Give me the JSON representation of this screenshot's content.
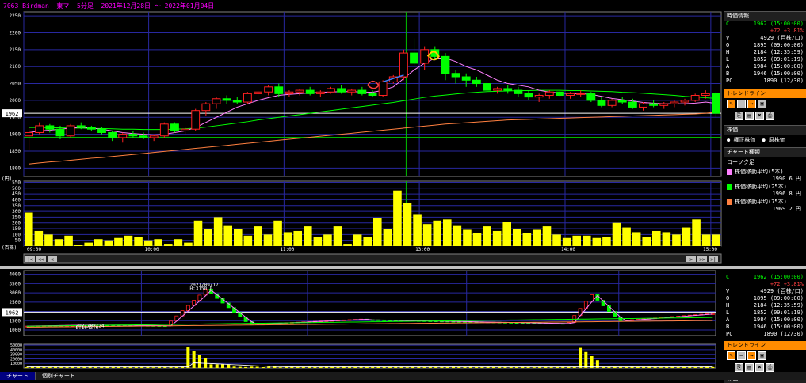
{
  "window": {
    "title": "7063 Birdman  東マ  5分足  2021年12月28日 〜 2022年01月04日"
  },
  "info_panel": {
    "header": "時価情報",
    "rows": [
      {
        "k": "C",
        "v": "1962 (15:00:00)",
        "color": "#00ff00"
      },
      {
        "k": "",
        "v": "+72 +3.81%",
        "color": "#ff4040"
      },
      {
        "k": "V",
        "v": "4929 (百株/口)",
        "color": "#ffffff"
      },
      {
        "k": "O",
        "v": "1895 (09:00:00)",
        "color": "#ffffff"
      },
      {
        "k": "H",
        "v": "2184 (12:35:59)",
        "color": "#ffffff"
      },
      {
        "k": "L",
        "v": "1852 (09:01:19)",
        "color": "#ffffff"
      },
      {
        "k": "A",
        "v": "1984 (15:00:00)",
        "color": "#ffffff"
      },
      {
        "k": "B",
        "v": "1946 (15:00:00)",
        "color": "#ffffff"
      },
      {
        "k": "PC",
        "v": "1890 (12/30)",
        "color": "#ffffff"
      }
    ]
  },
  "trendline": {
    "label": "トレンドライン"
  },
  "stock_price": {
    "header": "株価",
    "options": [
      "権正株価",
      "原株価"
    ]
  },
  "chart_type": {
    "header": "チャート種類",
    "kind": "ローソク足",
    "ma": [
      {
        "label": "株価移動平均(5本)",
        "value": "1990.6 円",
        "color": "#ff80ff"
      },
      {
        "label": "株価移動平均(25本)",
        "value": "1996.8 円",
        "color": "#00ff00"
      },
      {
        "label": "株価移動平均(75本)",
        "value": "1969.2 円",
        "color": "#ff8040"
      }
    ]
  },
  "bottom_info": {
    "rows": [
      {
        "k": "C",
        "v": "1962 (15:00:00)",
        "color": "#00ff00"
      },
      {
        "k": "",
        "v": "+72 +3.81%",
        "color": "#ff4040"
      },
      {
        "k": "V",
        "v": "4929 (百株/口)",
        "color": "#ffffff"
      },
      {
        "k": "O",
        "v": "1895 (09:00:00)",
        "color": "#ffffff"
      },
      {
        "k": "H",
        "v": "2184 (12:35:59)",
        "color": "#ffffff"
      },
      {
        "k": "L",
        "v": "1852 (09:01:19)",
        "color": "#ffffff"
      },
      {
        "k": "A",
        "v": "1984 (15:00:00)",
        "color": "#ffffff"
      },
      {
        "k": "B",
        "v": "1946 (15:00:00)",
        "color": "#ffffff"
      },
      {
        "k": "PC",
        "v": "1890 (12/30)",
        "color": "#ffffff"
      }
    ],
    "footer": "株価"
  },
  "tabs": [
    "チャート",
    "個別チャート"
  ],
  "chart_data": [
    {
      "type": "candlestick",
      "yticks": [
        1800,
        1850,
        1900,
        1950,
        2000,
        2050,
        2100,
        2150,
        2200,
        2250
      ],
      "ylim": [
        1775,
        2262
      ],
      "y_unit": "(円)",
      "current_price_label": "1962",
      "current_price": 1962,
      "hline": 1890,
      "xticks": [
        "09:00",
        "10:00",
        "11:00",
        "13:00",
        "14:00",
        "15:00"
      ],
      "candles": [
        [
          1895,
          1920,
          1852,
          1905
        ],
        [
          1905,
          1935,
          1900,
          1925
        ],
        [
          1925,
          1930,
          1905,
          1915
        ],
        [
          1915,
          1925,
          1885,
          1895
        ],
        [
          1895,
          1930,
          1890,
          1925
        ],
        [
          1925,
          1935,
          1915,
          1920
        ],
        [
          1920,
          1925,
          1910,
          1915
        ],
        [
          1915,
          1920,
          1900,
          1905
        ],
        [
          1905,
          1910,
          1880,
          1890
        ],
        [
          1890,
          1905,
          1875,
          1900
        ],
        [
          1900,
          1910,
          1890,
          1895
        ],
        [
          1895,
          1905,
          1885,
          1890
        ],
        [
          1890,
          1900,
          1880,
          1895
        ],
        [
          1895,
          1935,
          1890,
          1930
        ],
        [
          1930,
          1935,
          1905,
          1910
        ],
        [
          1910,
          1920,
          1900,
          1915
        ],
        [
          1915,
          1975,
          1910,
          1970
        ],
        [
          1970,
          1995,
          1955,
          1990
        ],
        [
          1990,
          2010,
          1975,
          2005
        ],
        [
          2005,
          2015,
          1990,
          2000
        ],
        [
          2000,
          2010,
          1990,
          1995
        ],
        [
          1995,
          2025,
          1990,
          2020
        ],
        [
          2020,
          2030,
          2005,
          2025
        ],
        [
          2025,
          2045,
          2015,
          2040
        ],
        [
          2040,
          2050,
          2010,
          2020
        ],
        [
          2020,
          2030,
          2010,
          2025
        ],
        [
          2025,
          2035,
          2015,
          2030
        ],
        [
          2030,
          2040,
          2015,
          2020
        ],
        [
          2020,
          2030,
          2010,
          2025
        ],
        [
          2025,
          2040,
          2020,
          2035
        ],
        [
          2035,
          2045,
          2020,
          2025
        ],
        [
          2025,
          2035,
          2015,
          2030
        ],
        [
          2030,
          2040,
          2015,
          2020
        ],
        [
          2020,
          2030,
          2010,
          2015
        ],
        [
          2015,
          2060,
          2010,
          2055
        ],
        [
          2055,
          2075,
          2050,
          2070
        ],
        [
          2070,
          2150,
          2060,
          2140
        ],
        [
          2140,
          2184,
          2100,
          2110
        ],
        [
          2110,
          2160,
          2090,
          2150
        ],
        [
          2150,
          2160,
          2120,
          2130
        ],
        [
          2130,
          2140,
          2060,
          2080
        ],
        [
          2080,
          2090,
          2050,
          2070
        ],
        [
          2070,
          2080,
          2040,
          2060
        ],
        [
          2060,
          2070,
          2040,
          2050
        ],
        [
          2050,
          2060,
          2020,
          2030
        ],
        [
          2030,
          2040,
          2020,
          2035
        ],
        [
          2035,
          2045,
          2020,
          2030
        ],
        [
          2030,
          2040,
          2010,
          2020
        ],
        [
          2020,
          2030,
          2000,
          2010
        ],
        [
          2010,
          2020,
          1995,
          2015
        ],
        [
          2015,
          2030,
          2005,
          2025
        ],
        [
          2025,
          2030,
          2010,
          2015
        ],
        [
          2015,
          2025,
          2005,
          2020
        ],
        [
          2020,
          2030,
          2010,
          2020
        ],
        [
          2020,
          2025,
          1995,
          2000
        ],
        [
          2000,
          2010,
          1980,
          1985
        ],
        [
          1985,
          2005,
          1980,
          2000
        ],
        [
          2000,
          2010,
          1990,
          1995
        ],
        [
          1995,
          2005,
          1975,
          1980
        ],
        [
          1980,
          1995,
          1970,
          1990
        ],
        [
          1990,
          2000,
          1980,
          1985
        ],
        [
          1985,
          1995,
          1975,
          1990
        ],
        [
          1990,
          2000,
          1980,
          1995
        ],
        [
          1995,
          2005,
          1985,
          2000
        ],
        [
          2000,
          2020,
          1995,
          2015
        ],
        [
          2015,
          2030,
          2005,
          2020
        ],
        [
          2020,
          2025,
          1950,
          1962
        ]
      ],
      "ma5": [
        1905,
        1910,
        1912,
        1915,
        1918,
        1920,
        1918,
        1915,
        1910,
        1905,
        1902,
        1900,
        1898,
        1900,
        1905,
        1910,
        1920,
        1935,
        1950,
        1965,
        1980,
        1990,
        2000,
        2008,
        2015,
        2018,
        2020,
        2022,
        2024,
        2025,
        2026,
        2026,
        2025,
        2024,
        2030,
        2040,
        2065,
        2090,
        2110,
        2125,
        2125,
        2115,
        2100,
        2090,
        2075,
        2060,
        2050,
        2045,
        2040,
        2030,
        2025,
        2022,
        2020,
        2020,
        2018,
        2012,
        2006,
        2002,
        1998,
        1994,
        1992,
        1990,
        1990,
        1990,
        1992,
        1995,
        1991
      ],
      "ma25": [
        1920,
        1920,
        1919,
        1919,
        1918,
        1918,
        1917,
        1917,
        1916,
        1915,
        1915,
        1914,
        1914,
        1914,
        1915,
        1916,
        1918,
        1921,
        1925,
        1929,
        1933,
        1937,
        1942,
        1946,
        1950,
        1954,
        1958,
        1962,
        1966,
        1970,
        1974,
        1978,
        1982,
        1986,
        1990,
        1994,
        1999,
        2004,
        2009,
        2013,
        2016,
        2019,
        2022,
        2024,
        2026,
        2027,
        2028,
        2029,
        2029,
        2030,
        2030,
        2030,
        2029,
        2029,
        2028,
        2027,
        2026,
        2024,
        2023,
        2021,
        2019,
        2017,
        2015,
        2012,
        2010,
        2008,
        2006
      ],
      "ma75": [
        1812,
        1815,
        1818,
        1820,
        1823,
        1826,
        1829,
        1831,
        1834,
        1837,
        1840,
        1843,
        1846,
        1849,
        1852,
        1855,
        1858,
        1861,
        1864,
        1867,
        1870,
        1873,
        1876,
        1879,
        1882,
        1885,
        1888,
        1891,
        1894,
        1897,
        1900,
        1903,
        1906,
        1909,
        1912,
        1915,
        1918,
        1921,
        1924,
        1927,
        1930,
        1932,
        1934,
        1936,
        1938,
        1940,
        1942,
        1943,
        1944,
        1945,
        1946,
        1947,
        1948,
        1949,
        1950,
        1951,
        1952,
        1953,
        1954,
        1955,
        1956,
        1957,
        1958,
        1959,
        1960,
        1962,
        1965
      ],
      "volume": [
        290,
        130,
        100,
        60,
        90,
        10,
        30,
        60,
        50,
        70,
        90,
        80,
        50,
        60,
        20,
        60,
        30,
        220,
        150,
        250,
        180,
        150,
        90,
        170,
        100,
        220,
        120,
        130,
        170,
        80,
        100,
        170,
        20,
        100,
        80,
        240,
        150,
        480,
        370,
        270,
        190,
        220,
        230,
        180,
        140,
        110,
        170,
        130,
        210,
        150,
        110,
        140,
        170,
        100,
        70,
        90,
        90,
        70,
        80,
        200,
        160,
        120,
        80,
        130,
        120,
        100,
        160,
        230,
        100,
        100
      ],
      "volume_yticks": [
        50,
        100,
        150,
        200,
        250,
        300,
        350,
        400,
        450,
        500,
        550
      ],
      "volume_unit": "(百株)"
    },
    {
      "type": "candlestick",
      "yticks": [
        1000,
        1500,
        2000,
        2500,
        3000,
        3500,
        4000
      ],
      "current_price_label": "1962",
      "annotations": [
        {
          "text": "2021/09/17",
          "x": 0.24,
          "y": 3350
        },
        {
          "text": "H:3150.0",
          "x": 0.24,
          "y": 3150
        },
        {
          "text": "2021/08/24",
          "x": 0.075,
          "y": 1150
        },
        {
          "text": "L:1043.0",
          "x": 0.075,
          "y": 1043
        }
      ],
      "volume_yticks": [
        10000,
        20000,
        30000,
        40000,
        50000
      ]
    }
  ]
}
